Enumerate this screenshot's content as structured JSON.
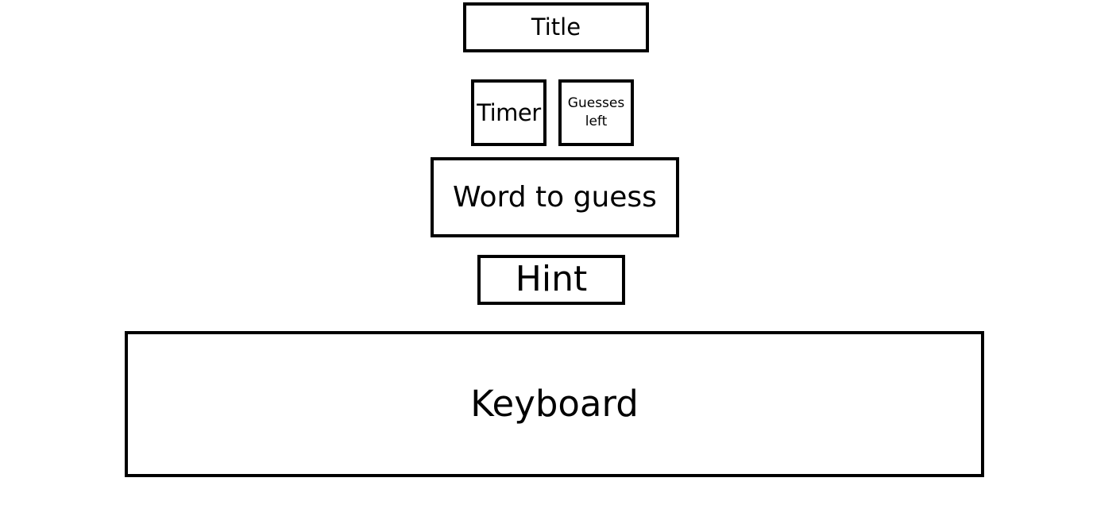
{
  "layout_labels": {
    "title": "Title",
    "timer": "Timer",
    "guesses_left": "Guesses\nleft",
    "word_to_guess": "Word to guess",
    "hint": "Hint",
    "keyboard": "Keyboard"
  }
}
